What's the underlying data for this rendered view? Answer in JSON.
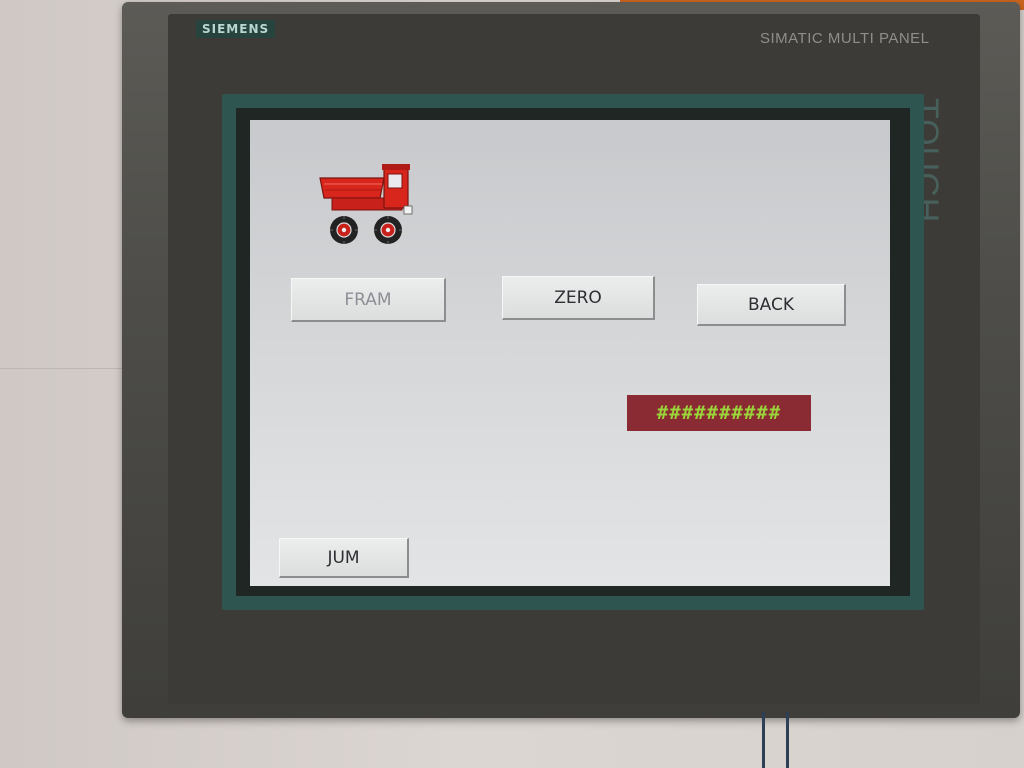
{
  "device": {
    "brand": "SIEMENS",
    "model": "SIMATIC MULTI PANEL",
    "touch_label": "TOUCH"
  },
  "screen": {
    "buttons": {
      "fram": {
        "label": "FRAM",
        "state": "disabled"
      },
      "zero": {
        "label": "ZERO",
        "state": "enabled"
      },
      "back": {
        "label": "BACK",
        "state": "enabled"
      },
      "jum": {
        "label": "JUM",
        "state": "enabled"
      }
    },
    "value_display": "##########",
    "graphic": "dump-truck-icon"
  },
  "colors": {
    "screen_bg": "#d4d6d8",
    "display_bg": "#8a2a33",
    "display_text": "#9bd43a",
    "truck": "#d8261d",
    "bezel": "#4e4d49",
    "frame_accent": "#2f5550"
  }
}
